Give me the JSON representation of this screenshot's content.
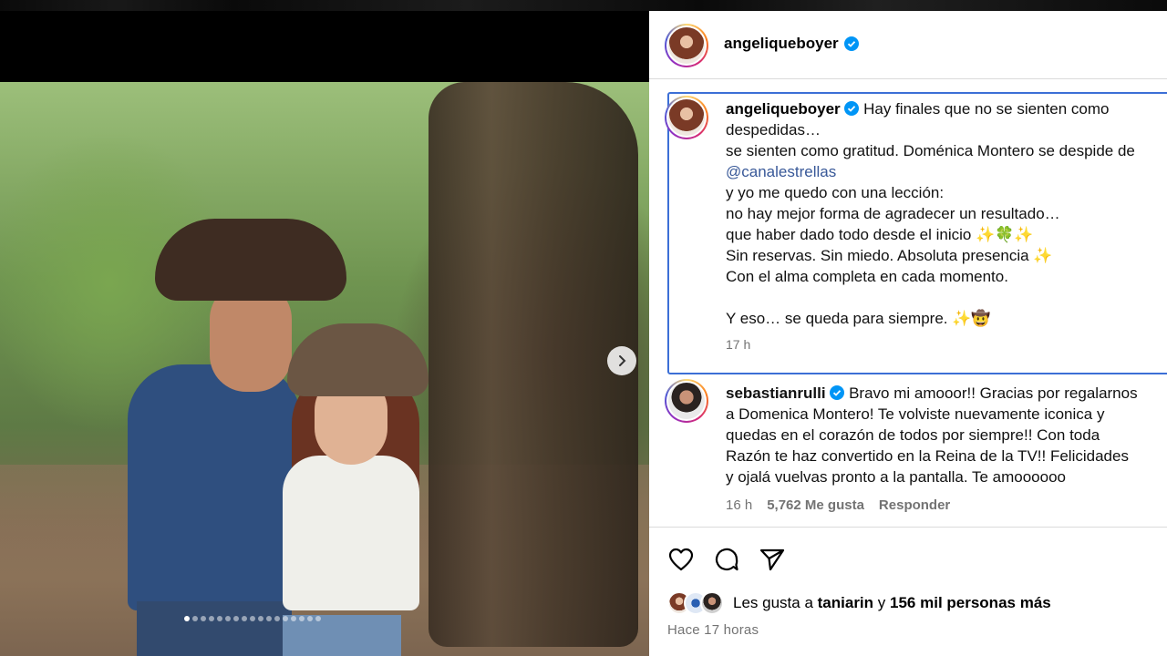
{
  "post": {
    "author": "angeliqueboyer",
    "carousel_dots": 17,
    "active_dot": 0
  },
  "caption": {
    "author": "angeliqueboyer",
    "lines": [
      "Hay finales que no se sienten como",
      "despedidas…",
      "se sienten como gratitud. Doménica Montero se despide de"
    ],
    "mention": "@canalestrellas",
    "lines2": [
      "y yo me quedo con una lección:",
      "no hay mejor forma de agradecer un resultado…",
      "que haber dado todo desde el inicio ✨🍀✨",
      "Sin reservas. Sin miedo. Absoluta presencia ✨",
      "Con el alma completa en cada momento."
    ],
    "closing": "Y eso… se queda para siempre. ✨🤠",
    "time": "17 h"
  },
  "comment": {
    "author": "sebastianrulli",
    "lines": [
      "Bravo mi amooor!! Gracias por regalarnos",
      "a Domenica Montero! Te volviste nuevamente iconica y",
      "quedas en el corazón de todos por siempre!! Con toda",
      "Razón te haz convertido en la Reina de la TV!! Felicidades",
      "y ojalá vuelvas pronto a la pantalla. Te amoooooo"
    ],
    "time": "16 h",
    "likes": "5,762 Me gusta",
    "reply": "Responder"
  },
  "likes": {
    "prefix": "Les gusta a",
    "user": "taniarin",
    "connector": "y",
    "others": "156 mil personas más"
  },
  "posted": "Hace 17 horas",
  "icons": [
    "heart-icon",
    "comment-icon",
    "share-icon",
    "next-arrow-icon",
    "verified-badge-icon"
  ],
  "colors": {
    "link": "#385898",
    "verified": "#0095f6",
    "highlight_border": "#3c6fd6",
    "muted": "#737373"
  }
}
